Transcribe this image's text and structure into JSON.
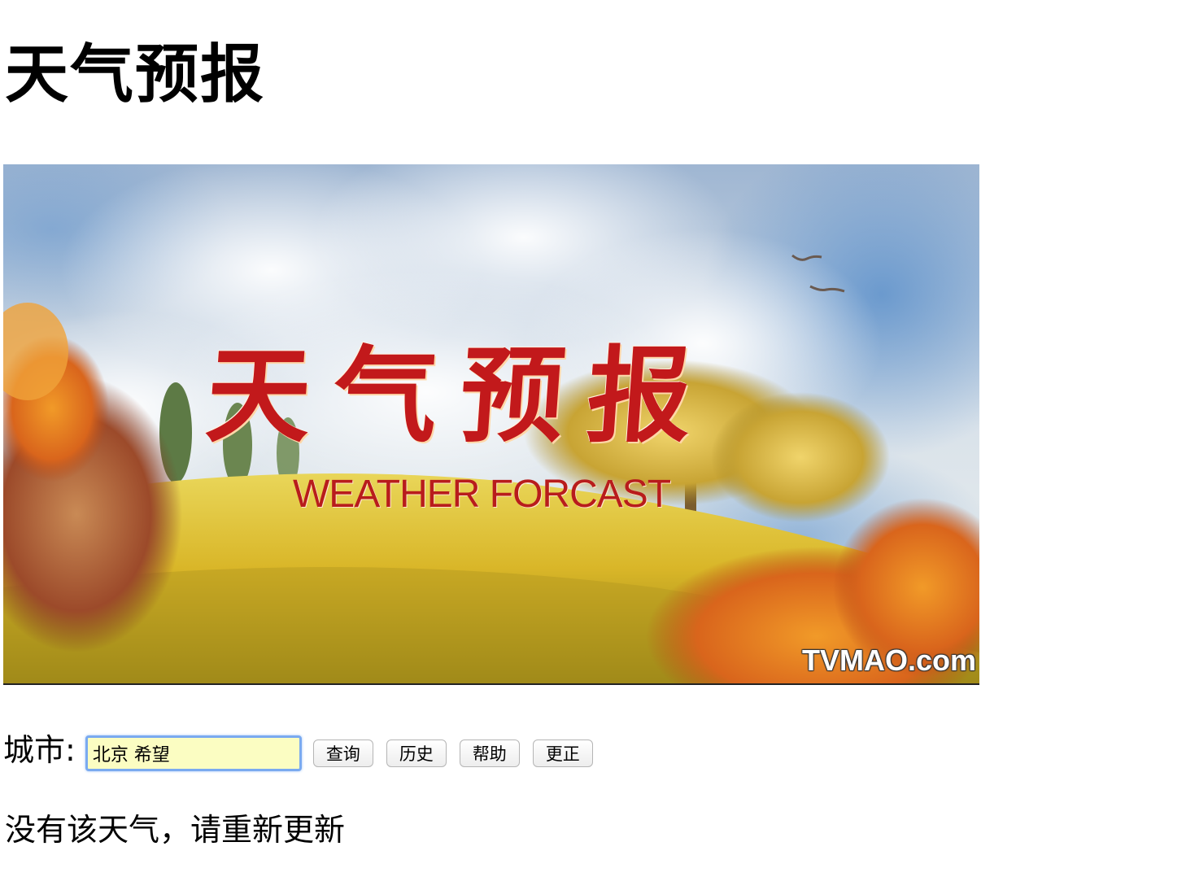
{
  "header": {
    "title": "天气预报"
  },
  "banner": {
    "title": "天气预报",
    "subtitle": "WEATHER FORCAST",
    "watermark": "TVMAO.com"
  },
  "form": {
    "city_label": "城市:",
    "city_value": "北京 希望",
    "buttons": {
      "query": "查询",
      "history": "历史",
      "help": "帮助",
      "correct": "更正"
    }
  },
  "message": "没有该天气，请重新更新"
}
